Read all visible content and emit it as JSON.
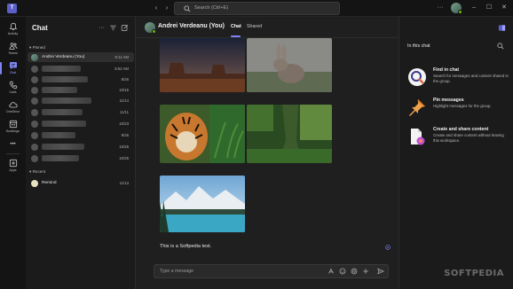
{
  "app": {
    "logo_letter": "T"
  },
  "titlebar": {
    "search_placeholder": "Search (Ctrl+E)",
    "more": "···",
    "minimize": "–",
    "maximize": "☐",
    "close": "✕"
  },
  "rail": {
    "items": [
      {
        "label": "Activity",
        "icon": "bell-icon"
      },
      {
        "label": "Teams",
        "icon": "teams-icon"
      },
      {
        "label": "Chat",
        "icon": "chat-icon"
      },
      {
        "label": "Calls",
        "icon": "phone-icon"
      },
      {
        "label": "OneDrive",
        "icon": "cloud-icon"
      },
      {
        "label": "Bookings",
        "icon": "bookings-icon"
      },
      {
        "label": "",
        "icon": "more-icon"
      },
      {
        "label": "Apps",
        "icon": "apps-icon"
      }
    ],
    "more_glyph": "•••"
  },
  "chatlist": {
    "title": "Chat",
    "pinned_label": "Pinned",
    "recent_label": "Recent",
    "rows": [
      {
        "name": "Andrei Verdeanu (You)",
        "time": "9:11 AM"
      },
      {
        "name": "",
        "time": "8:52 AM"
      },
      {
        "name": "",
        "time": "8/26"
      },
      {
        "name": "",
        "time": "10/15"
      },
      {
        "name": "",
        "time": "11/14"
      },
      {
        "name": "",
        "time": "11/11"
      },
      {
        "name": "",
        "time": "10/23"
      },
      {
        "name": "",
        "time": "9/26"
      },
      {
        "name": "",
        "time": "10/25"
      },
      {
        "name": "",
        "time": "10/25"
      }
    ],
    "recent_rows": [
      {
        "name": "Remind",
        "time": "11/13"
      }
    ]
  },
  "conversation": {
    "name": "Andrei Verdeanu (You)",
    "tabs": [
      "Chat",
      "Shared"
    ],
    "message_text": "This is a Softpedia test.",
    "composer_placeholder": "Type a message"
  },
  "right_panel": {
    "title": "In this chat",
    "features": [
      {
        "title": "Find in chat",
        "desc": "Search for messages and content shared in the group."
      },
      {
        "title": "Pin messages",
        "desc": "Highlight messages for the group."
      },
      {
        "title": "Create and share content",
        "desc": "Create and share content without leaving this workspace."
      }
    ]
  },
  "watermark": "SOFTPEDIA",
  "colors": {
    "accent": "#7f85f5",
    "presence": "#6bb700",
    "background": "#1f1f1f"
  }
}
